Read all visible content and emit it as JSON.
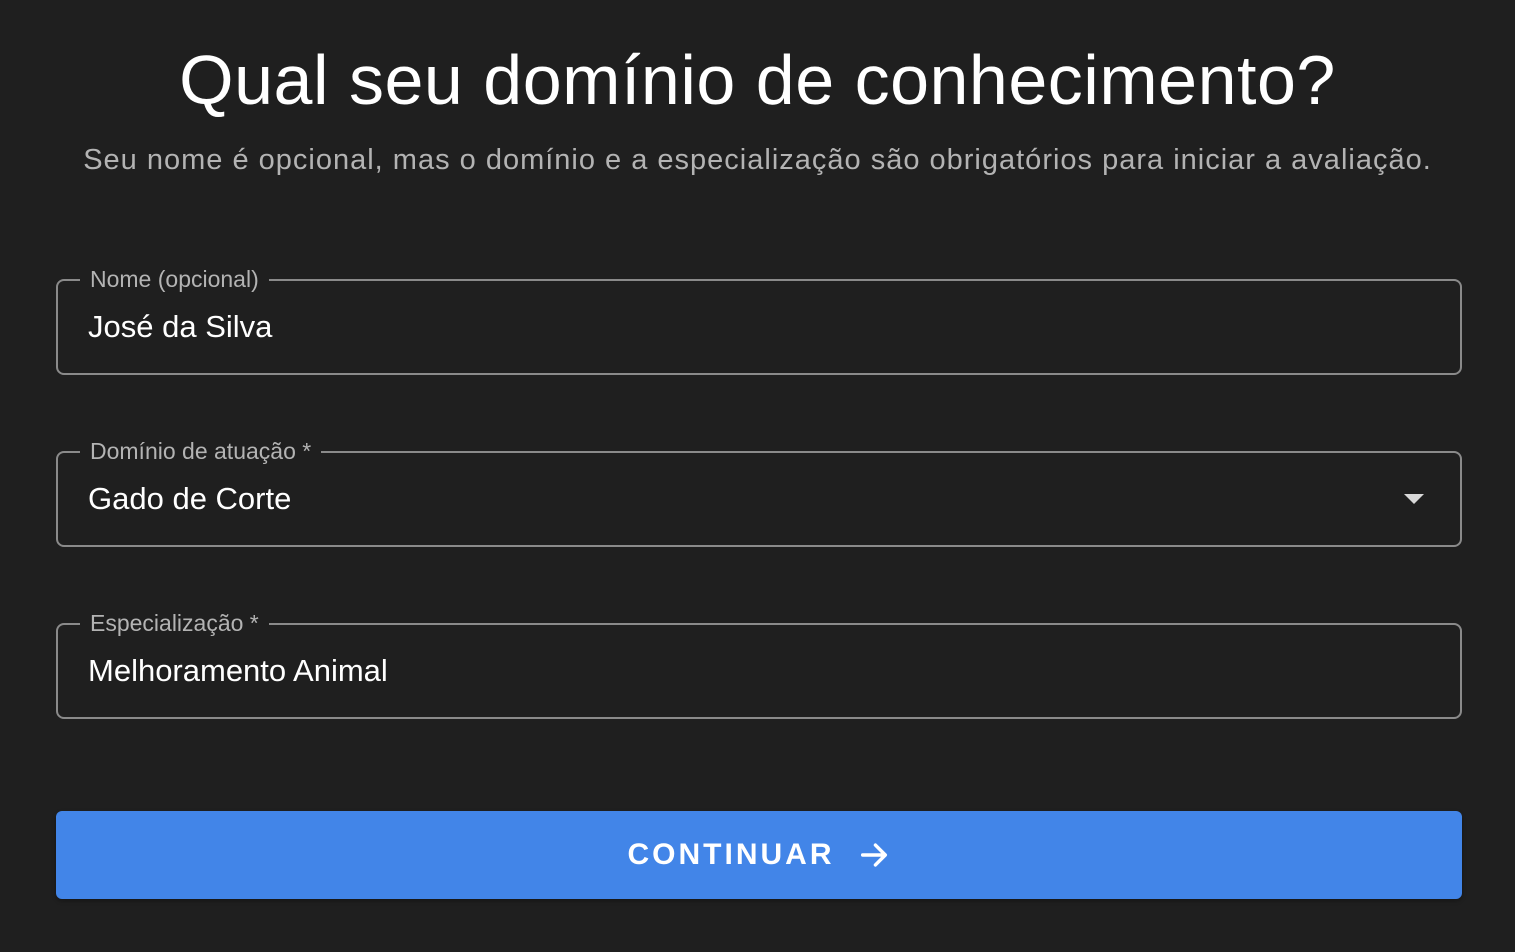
{
  "header": {
    "title": "Qual seu domínio de conhecimento?",
    "subtitle": "Seu nome é opcional, mas o domínio e a especialização são obrigatórios para iniciar a avaliação."
  },
  "form": {
    "name_field": {
      "label": "Nome (opcional)",
      "value": "José da Silva"
    },
    "domain_field": {
      "label": "Domínio de atuação *",
      "value": "Gado de Corte",
      "icon": "chevron-down-icon"
    },
    "specialization_field": {
      "label": "Especialização *",
      "value": "Melhoramento Animal"
    }
  },
  "continue_button": {
    "label": "CONTINUAR",
    "icon": "arrow-right-icon",
    "color": "#4285e8"
  },
  "colors": {
    "background": "#1f1f1f",
    "border": "#8a8a8a",
    "muted_text": "#b3b3b3"
  }
}
